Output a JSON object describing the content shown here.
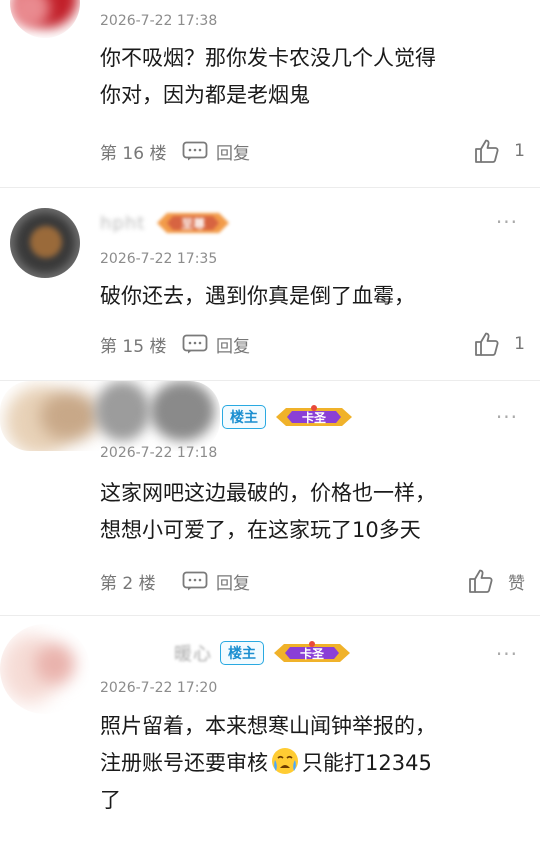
{
  "comments": [
    {
      "name": "",
      "time": "2026-7-22 17:38",
      "text": [
        "你不吸烟？那你发卡农没几个人觉得",
        "你对，因为都是老烟鬼"
      ],
      "floor": "第 16 楼",
      "reply": "回复",
      "likes": "1"
    },
    {
      "name": "hpht",
      "badge_level": "至尊",
      "time": "2026-7-22 17:35",
      "text": [
        "破你还去，遇到你真是倒了血霉，"
      ],
      "floor": "第 15 楼",
      "reply": "回复",
      "likes": "1"
    },
    {
      "name": "",
      "host_badge": "楼主",
      "badge_level": "卡圣",
      "time": "2026-7-22 17:18",
      "text": [
        "这家网吧这边最破的，价格也一样，",
        "想想小可爱了，在这家玩了10多天"
      ],
      "floor": "第 2 楼",
      "reply": "回复",
      "likes": "赞"
    },
    {
      "name": "暖心",
      "host_badge": "楼主",
      "badge_level": "卡圣",
      "time": "2026-7-22 17:20",
      "text_line1": "照片留着，本来想寒山闻钟举报的，",
      "text_line2a": "注册账号还要审核",
      "text_line2b": "只能打12345",
      "text_line3": "了"
    }
  ],
  "icons": {
    "more": "more-dots-icon",
    "reply": "reply-bubble-icon",
    "like": "thumbs-up-icon",
    "emoji": "crying-face-emoji"
  },
  "colors": {
    "host_badge": "#29a9e1",
    "level_badge": "#8a3fd6"
  }
}
